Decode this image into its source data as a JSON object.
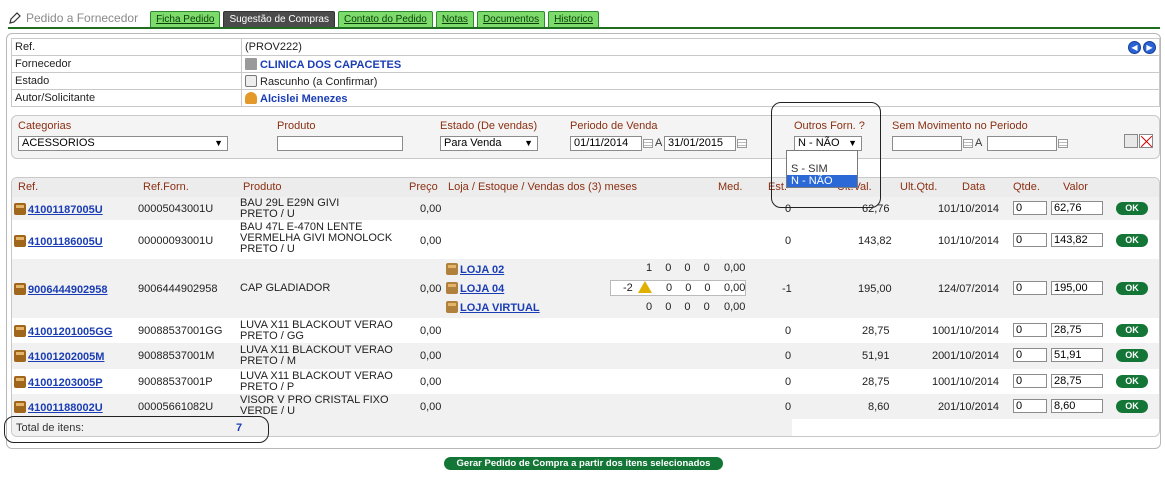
{
  "app": {
    "title": "Pedido a Fornecedor"
  },
  "tabs": [
    {
      "label": "Ficha Pedido",
      "active": false
    },
    {
      "label": "Sugestão de Compras",
      "active": true
    },
    {
      "label": "Contato do Pedido",
      "active": false
    },
    {
      "label": "Notas",
      "active": false
    },
    {
      "label": "Documentos",
      "active": false
    },
    {
      "label": "Historico",
      "active": false
    }
  ],
  "header": {
    "ref_label": "Ref.",
    "ref_value": "(PROV222)",
    "supplier_label": "Fornecedor",
    "supplier_value": "CLINICA DOS CAPACETES",
    "state_label": "Estado",
    "state_value": "Rascunho (a Confirmar)",
    "author_label": "Autor/Solicitante",
    "author_value": "Alcislei Menezes"
  },
  "filters": {
    "category_label": "Categorias",
    "category_value": "ACESSORIOS",
    "product_label": "Produto",
    "product_value": "",
    "sale_state_label": "Estado (De vendas)",
    "sale_state_value": "Para Venda",
    "period_label": "Periodo de Venda",
    "period_from": "01/11/2014",
    "period_sep": "A",
    "period_to": "31/01/2015",
    "other_suppliers_label": "Outros Forn. ?",
    "other_suppliers_value": "N - NÃO",
    "no_movement_label": "Sem Movimento no Periodo",
    "no_movement_sep": "A",
    "other_suppliers_options": [
      "S - SIM",
      "N - NÃO"
    ]
  },
  "grid": {
    "columns": {
      "ref": "Ref.",
      "ref_forn": "Ref.Forn.",
      "product": "Produto",
      "price": "Preço",
      "store": "Loja / Estoque / Vendas dos (3) meses",
      "med": "Med.",
      "est": "Est.",
      "ult_val": "Ult.Val.",
      "ult_qtd": "Ult.Qtd.",
      "date": "Data",
      "qty": "Qtde.",
      "value": "Valor"
    },
    "ok_label": "OK",
    "rows": [
      {
        "ref": "41001187005U",
        "ref_forn": "00005043001U",
        "product": [
          "BAU 29L E29N GIVI",
          "PRETO / U"
        ],
        "price": "0,00",
        "est": "0",
        "ult_val": "62,76",
        "ult_qtd": "1",
        "date": "01/10/2014",
        "qty": "0",
        "value": "62,76"
      },
      {
        "ref": "41001186005U",
        "ref_forn": "00000093001U",
        "product": [
          "BAU 47L E-470N LENTE",
          "VERMELHA GIVI MONOLOCK",
          "PRETO / U"
        ],
        "price": "0,00",
        "est": "0",
        "ult_val": "143,82",
        "ult_qtd": "1",
        "date": "01/10/2014",
        "qty": "0",
        "value": "143,82"
      },
      {
        "ref": "9006444902958",
        "ref_forn": "9006444902958",
        "product": [
          "CAP GLADIADOR"
        ],
        "price": "0,00",
        "est": "-1",
        "ult_val": "195,00",
        "ult_qtd": "1",
        "date": "24/07/2014",
        "qty": "0",
        "value": "195,00",
        "stores": [
          {
            "name": "LOJA 02",
            "vals": [
              "1",
              "0",
              "0",
              "0"
            ],
            "med": "0,00"
          },
          {
            "name": "LOJA 04",
            "vals": [
              "-2",
              "0",
              "0",
              "0"
            ],
            "med": "0,00"
          },
          {
            "name": "LOJA VIRTUAL",
            "vals": [
              "0",
              "0",
              "0",
              "0"
            ],
            "med": "0,00"
          }
        ]
      },
      {
        "ref": "41001201005GG",
        "ref_forn": "90088537001GG",
        "product": [
          "LUVA X11 BLACKOUT VERAO",
          "PRETO / GG"
        ],
        "price": "0,00",
        "est": "0",
        "ult_val": "28,75",
        "ult_qtd": "10",
        "date": "01/10/2014",
        "qty": "0",
        "value": "28,75"
      },
      {
        "ref": "41001202005M",
        "ref_forn": "90088537001M",
        "product": [
          "LUVA X11 BLACKOUT VERAO",
          "PRETO / M"
        ],
        "price": "0,00",
        "est": "0",
        "ult_val": "51,91",
        "ult_qtd": "20",
        "date": "01/10/2014",
        "qty": "0",
        "value": "51,91"
      },
      {
        "ref": "41001203005P",
        "ref_forn": "90088537001P",
        "product": [
          "LUVA X11 BLACKOUT VERAO",
          "PRETO / P"
        ],
        "price": "0,00",
        "est": "0",
        "ult_val": "28,75",
        "ult_qtd": "10",
        "date": "01/10/2014",
        "qty": "0",
        "value": "28,75"
      },
      {
        "ref": "41001188002U",
        "ref_forn": "00005661082U",
        "product": [
          "VISOR V PRO CRISTAL FIXO",
          "VERDE / U"
        ],
        "price": "0,00",
        "est": "0",
        "ult_val": "8,60",
        "ult_qtd": "2",
        "date": "01/10/2014",
        "qty": "0",
        "value": "8,60"
      }
    ],
    "total_label": "Total de itens:",
    "total_value": "7"
  },
  "footer": {
    "generate_button": "Gerar Pedido de Compra a partir dos itens selecionados"
  },
  "colors": {
    "tab_green": "#7cdb6a",
    "accent_green": "#137536",
    "link_blue": "#1a3db5",
    "label_brown": "#8b2f12"
  }
}
